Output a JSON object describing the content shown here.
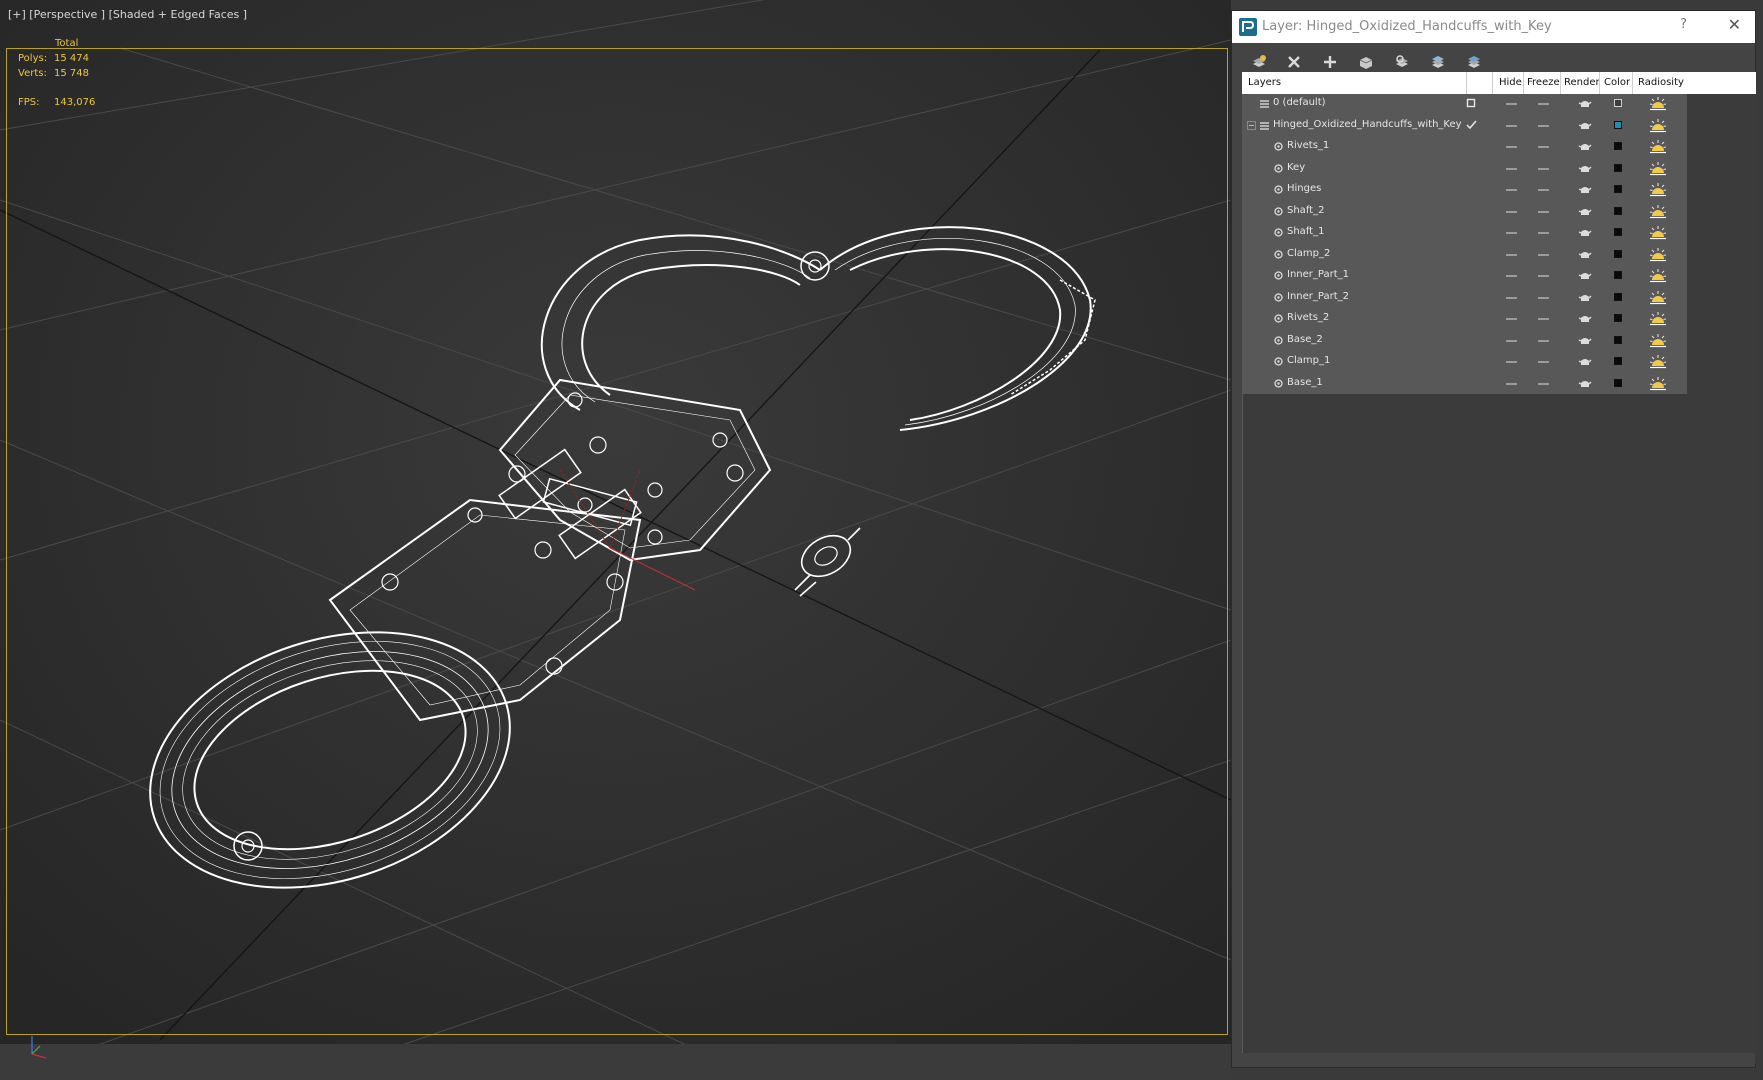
{
  "viewport": {
    "label": "[+] [Perspective ] [Shaded + Edged Faces ]",
    "stats": {
      "total_label": "Total",
      "polys_label": "Polys:",
      "polys_value": "15 474",
      "verts_label": "Verts:",
      "verts_value": "15 748",
      "fps_label": "FPS:",
      "fps_value": "143,076"
    },
    "frame_color": "#b9a21e",
    "stats_color": "#e9c63a"
  },
  "dialog": {
    "title": "Layer: Hinged_Oxidized_Handcuffs_with_Key",
    "help": "?",
    "close": "✕",
    "toolbar": [
      {
        "name": "create-new-layer-icon"
      },
      {
        "name": "delete-layer-icon"
      },
      {
        "name": "add-to-layer-icon"
      },
      {
        "name": "select-objects-icon"
      },
      {
        "name": "highlight-selected-icon"
      },
      {
        "name": "hide-all-layers-icon"
      },
      {
        "name": "freeze-all-layers-icon"
      }
    ],
    "columns": {
      "layers": "Layers",
      "hide": "Hide",
      "freeze": "Freeze",
      "render": "Render",
      "color": "Color",
      "radiosity": "Radiosity"
    },
    "layers": [
      {
        "name": "0 (default)",
        "level": 0,
        "active": false,
        "color": "#3d3d3d"
      },
      {
        "name": "Hinged_Oxidized_Handcuffs_with_Key",
        "level": 0,
        "active": true,
        "color": "#1e8fb3"
      },
      {
        "name": "Rivets_1",
        "level": 1,
        "color": "#0a0a0a"
      },
      {
        "name": "Key",
        "level": 1,
        "color": "#0a0a0a"
      },
      {
        "name": "Hinges",
        "level": 1,
        "color": "#0a0a0a"
      },
      {
        "name": "Shaft_2",
        "level": 1,
        "color": "#0a0a0a"
      },
      {
        "name": "Shaft_1",
        "level": 1,
        "color": "#0a0a0a"
      },
      {
        "name": "Clamp_2",
        "level": 1,
        "color": "#0a0a0a"
      },
      {
        "name": "Inner_Part_1",
        "level": 1,
        "color": "#0a0a0a"
      },
      {
        "name": "Inner_Part_2",
        "level": 1,
        "color": "#0a0a0a"
      },
      {
        "name": "Rivets_2",
        "level": 1,
        "color": "#0a0a0a"
      },
      {
        "name": "Base_2",
        "level": 1,
        "color": "#0a0a0a"
      },
      {
        "name": "Clamp_1",
        "level": 1,
        "color": "#0a0a0a"
      },
      {
        "name": "Base_1",
        "level": 1,
        "color": "#0a0a0a"
      }
    ]
  }
}
